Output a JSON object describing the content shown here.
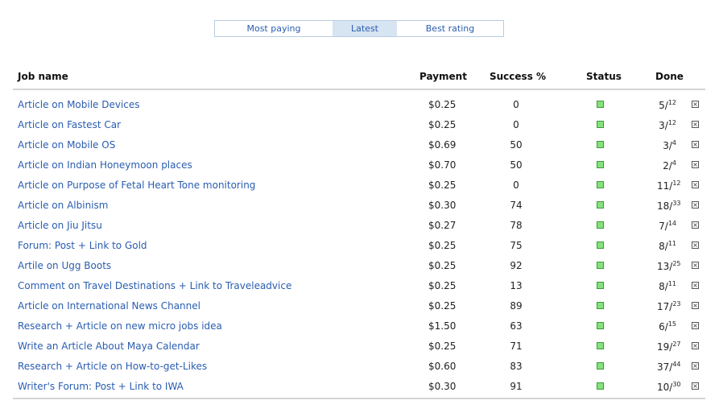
{
  "tabs": [
    {
      "label": "Most paying",
      "active": false
    },
    {
      "label": "Latest",
      "active": true
    },
    {
      "label": "Best rating",
      "active": false
    }
  ],
  "columns": {
    "job": "Job name",
    "payment": "Payment",
    "success": "Success %",
    "status": "Status",
    "done": "Done"
  },
  "rows": [
    {
      "job": "Article on Mobile Devices",
      "payment": "$0.25",
      "success": "0",
      "done": "5",
      "total": "12"
    },
    {
      "job": "Article on Fastest Car",
      "payment": "$0.25",
      "success": "0",
      "done": "3",
      "total": "12"
    },
    {
      "job": "Article on Mobile OS",
      "payment": "$0.69",
      "success": "50",
      "done": "3",
      "total": "4"
    },
    {
      "job": "Article on Indian Honeymoon places",
      "payment": "$0.70",
      "success": "50",
      "done": "2",
      "total": "4"
    },
    {
      "job": "Article on Purpose of Fetal Heart Tone monitoring",
      "payment": "$0.25",
      "success": "0",
      "done": "11",
      "total": "12"
    },
    {
      "job": "Article on Albinism",
      "payment": "$0.30",
      "success": "74",
      "done": "18",
      "total": "33"
    },
    {
      "job": "Article on Jiu Jitsu",
      "payment": "$0.27",
      "success": "78",
      "done": "7",
      "total": "14"
    },
    {
      "job": "Forum: Post + Link to Gold",
      "payment": "$0.25",
      "success": "75",
      "done": "8",
      "total": "11"
    },
    {
      "job": "Artile on Ugg Boots",
      "payment": "$0.25",
      "success": "92",
      "done": "13",
      "total": "25"
    },
    {
      "job": "Comment on Travel Destinations + Link to Traveleadvice",
      "payment": "$0.25",
      "success": "13",
      "done": "8",
      "total": "11"
    },
    {
      "job": "Article on International News Channel",
      "payment": "$0.25",
      "success": "89",
      "done": "17",
      "total": "23"
    },
    {
      "job": "Research + Article on new micro jobs idea",
      "payment": "$1.50",
      "success": "63",
      "done": "6",
      "total": "15"
    },
    {
      "job": "Write an Article About Maya Calendar",
      "payment": "$0.25",
      "success": "71",
      "done": "19",
      "total": "27"
    },
    {
      "job": "Research + Article on How-to-get-Likes",
      "payment": "$0.60",
      "success": "83",
      "done": "37",
      "total": "44"
    },
    {
      "job": "Writer's Forum: Post + Link to IWA",
      "payment": "$0.30",
      "success": "91",
      "done": "10",
      "total": "30"
    }
  ],
  "colors": {
    "link": "#2a5db0",
    "status_green": "#84e27b",
    "active_tab": "#d7e4f2"
  },
  "icons": {
    "status": "status-square-icon",
    "dismiss": "close-box-icon"
  }
}
